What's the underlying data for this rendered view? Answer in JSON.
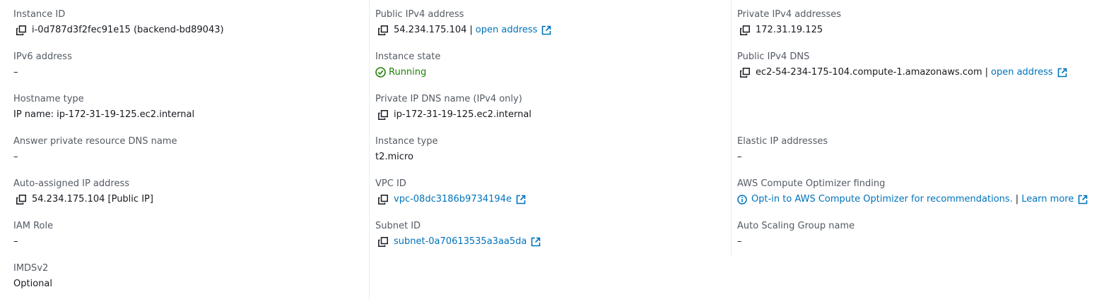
{
  "col1": {
    "instance_id": {
      "label": "Instance ID",
      "value": "i-0d787d3f2fec91e15 (backend-bd89043)"
    },
    "ipv6": {
      "label": "IPv6 address",
      "value": "–"
    },
    "hostname_type": {
      "label": "Hostname type",
      "value": "IP name: ip-172-31-19-125.ec2.internal"
    },
    "answer_dns": {
      "label": "Answer private resource DNS name",
      "value": "–"
    },
    "auto_ip": {
      "label": "Auto-assigned IP address",
      "value": "54.234.175.104 [Public IP]"
    },
    "iam_role": {
      "label": "IAM Role",
      "value": "–"
    },
    "imdsv2": {
      "label": "IMDSv2",
      "value": "Optional"
    }
  },
  "col2": {
    "public_ipv4": {
      "label": "Public IPv4 address",
      "value": "54.234.175.104",
      "separator": "|",
      "link": "open address"
    },
    "instance_state": {
      "label": "Instance state",
      "value": "Running"
    },
    "private_dns": {
      "label": "Private IP DNS name (IPv4 only)",
      "value": "ip-172-31-19-125.ec2.internal"
    },
    "instance_type": {
      "label": "Instance type",
      "value": "t2.micro"
    },
    "vpc_id": {
      "label": "VPC ID",
      "value": "vpc-08dc3186b9734194e"
    },
    "subnet_id": {
      "label": "Subnet ID",
      "value": "subnet-0a70613535a3aa5da"
    }
  },
  "col3": {
    "private_ipv4": {
      "label": "Private IPv4 addresses",
      "value": "172.31.19.125"
    },
    "public_dns": {
      "label": "Public IPv4 DNS",
      "value": "ec2-54-234-175-104.compute-1.amazonaws.com",
      "separator": "|",
      "link": "open address"
    },
    "elastic_ip": {
      "label": "Elastic IP addresses",
      "value": "–"
    },
    "optimizer": {
      "label": "AWS Compute Optimizer finding",
      "value": "Opt-in to AWS Compute Optimizer for recommendations.",
      "separator": "|",
      "link": "Learn more"
    },
    "asg": {
      "label": "Auto Scaling Group name",
      "value": "–"
    }
  },
  "colors": {
    "link": "#0073bb",
    "running": "#1d8102",
    "label": "#545b64"
  },
  "icons": {
    "copy": "copy-icon",
    "external": "external-link-icon",
    "status": "status-check-icon",
    "info": "info-icon"
  }
}
